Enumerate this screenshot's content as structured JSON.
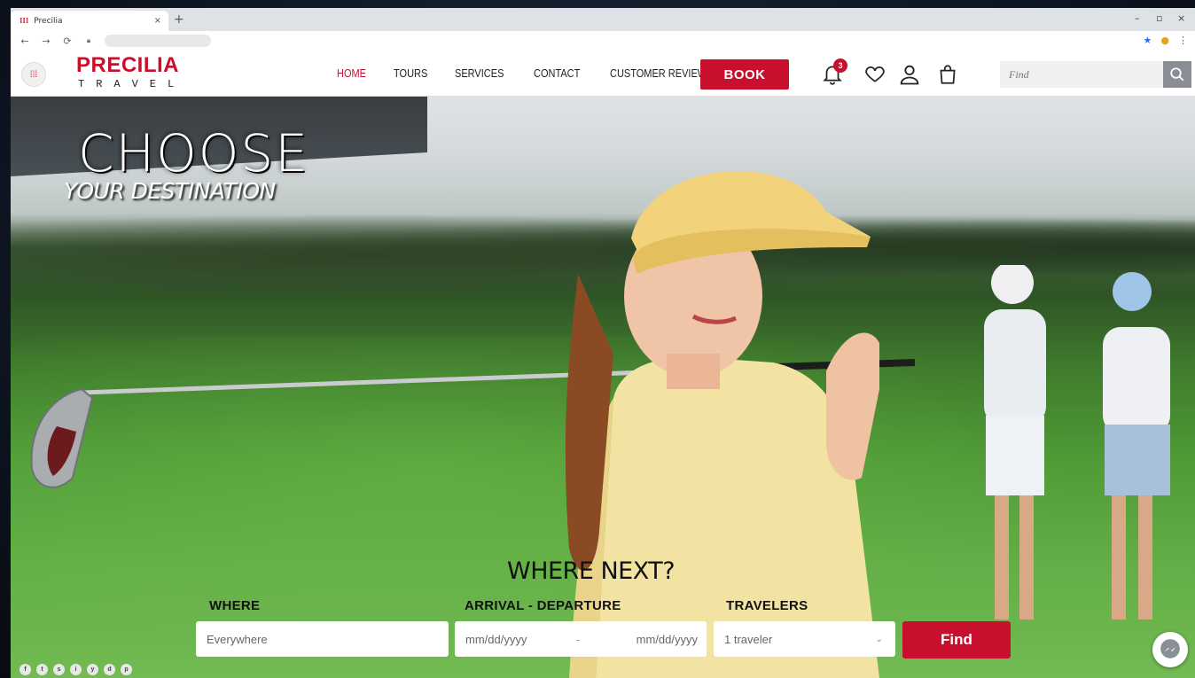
{
  "browser": {
    "tab_title": "Precilia",
    "tab_close": "×",
    "new_tab": "+",
    "url": "",
    "win_min": "–",
    "win_max": "▫",
    "win_close": "×"
  },
  "header": {
    "logo_main": "PRECILIA",
    "logo_sub": "TRAVEL",
    "nav": [
      "HOME",
      "TOURS",
      "SERVICES",
      "CONTACT",
      "CUSTOMER REVIEWS"
    ],
    "book_label": "BOOK",
    "notification_count": "3",
    "search_placeholder": "Find"
  },
  "hero": {
    "headline_line1": "CHOOSE",
    "headline_line2": "YOUR DESTINATION",
    "where_next": "WHERE NEXT?",
    "labels": {
      "where": "WHERE",
      "dates": "ARRIVAL - DEPARTURE",
      "travelers": "TRAVELERS"
    },
    "fields": {
      "where_value": "Everywhere",
      "arrival": "mm/dd/yyyy",
      "dash": "-",
      "departure": "mm/dd/yyyy",
      "travelers_value": "1 traveler"
    },
    "find_label": "Find"
  },
  "social": [
    "f",
    "t",
    "s",
    "i",
    "y",
    "d",
    "p"
  ],
  "colors": {
    "brand_red": "#c8102e",
    "nav_text": "#222222"
  }
}
